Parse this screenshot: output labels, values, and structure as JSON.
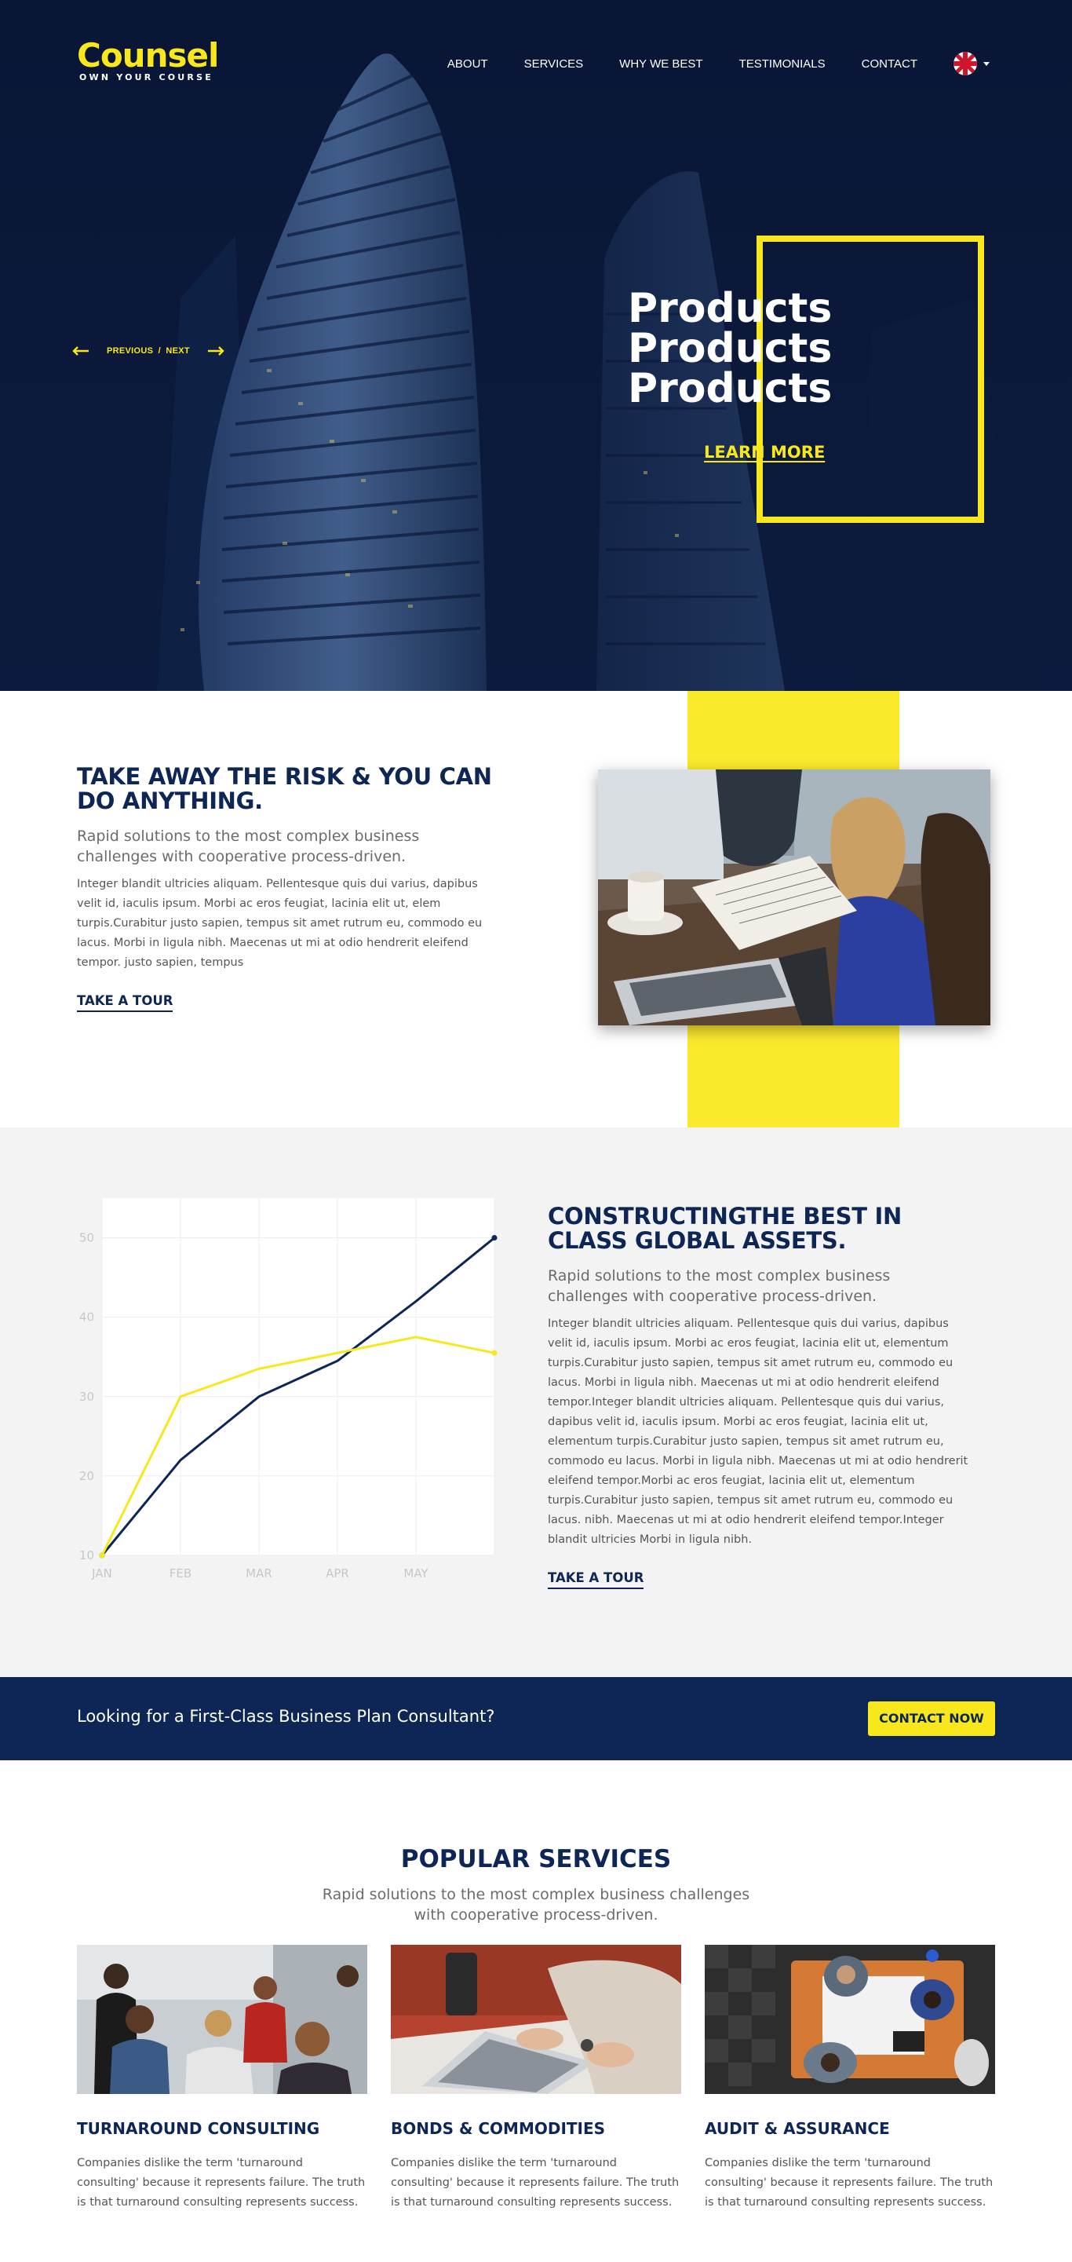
{
  "brand": {
    "name": "Counsel",
    "tagline": "OWN YOUR COURSE",
    "accent": "#f8e71c",
    "navy": "#0d2656"
  },
  "nav": {
    "items": [
      {
        "label": "ABOUT"
      },
      {
        "label": "SERVICES"
      },
      {
        "label": "WHY WE BEST"
      },
      {
        "label": "TESTIMONIALS"
      },
      {
        "label": "CONTACT"
      }
    ],
    "language_icon": "uk-flag-icon"
  },
  "hero": {
    "title_lines": [
      "Products",
      "Products",
      "Products"
    ],
    "cta": "LEARN MORE",
    "slider": {
      "prev": "PREVIOUS",
      "separator": "/",
      "next": "NEXT"
    }
  },
  "about": {
    "title": "TAKE AWAY THE RISK & YOU CAN DO ANYTHING.",
    "subtitle": "Rapid solutions to the most complex business challenges with cooperative process-driven.",
    "body": "Integer blandit ultricies aliquam. Pellentesque quis dui varius, dapibus velit id, iaculis ipsum. Morbi ac eros feugiat, lacinia elit ut, elem turpis.Curabitur justo sapien, tempus sit amet rutrum eu, commodo eu lacus. Morbi in ligula nibh. Maecenas ut mi at odio hendrerit eleifend tempor. justo sapien, tempus",
    "link": "TAKE A TOUR"
  },
  "assets": {
    "title": "CONSTRUCTINGTHE BEST IN CLASS GLOBAL ASSETS.",
    "subtitle": "Rapid solutions to the most complex business challenges with cooperative process-driven.",
    "body": "Integer blandit ultricies aliquam. Pellentesque quis dui varius, dapibus velit id, iaculis ipsum. Morbi ac eros feugiat, lacinia elit ut, elementum turpis.Curabitur justo sapien, tempus sit amet rutrum eu, commodo eu lacus. Morbi in ligula nibh. Maecenas ut mi at odio hendrerit eleifend tempor.Integer blandit ultricies aliquam. Pellentesque quis dui varius, dapibus velit id, iaculis ipsum. Morbi ac eros feugiat, lacinia elit ut, elementum turpis.Curabitur justo sapien, tempus sit amet rutrum eu, commodo eu lacus. Morbi in ligula nibh. Maecenas ut mi at odio hendrerit eleifend tempor.Morbi ac eros feugiat, lacinia elit ut, elementum turpis.Curabitur justo sapien, tempus sit amet rutrum eu, commodo eu lacus. nibh. Maecenas ut mi at odio hendrerit eleifend tempor.Integer blandit ultricies Morbi in ligula nibh.",
    "link": "TAKE A TOUR"
  },
  "chart_data": {
    "type": "line",
    "title": "",
    "xlabel": "",
    "ylabel": "",
    "x": [
      "JAN",
      "FEB",
      "MAR",
      "APR",
      "MAY",
      ""
    ],
    "yticks": [
      10,
      20,
      30,
      40,
      50
    ],
    "ylim": [
      10,
      55
    ],
    "grid": true,
    "legend": "none",
    "series": [
      {
        "color": "#0d2656",
        "values": [
          10,
          22,
          30,
          34.5,
          42,
          50
        ]
      },
      {
        "color": "#f8e71c",
        "values": [
          10,
          30,
          33.5,
          35.5,
          37.5,
          35.5
        ]
      }
    ]
  },
  "cta": {
    "text": "Looking for a First-Class Business Plan Consultant?",
    "button": "CONTACT NOW"
  },
  "services": {
    "title": "POPULAR SERVICES",
    "subtitle": "Rapid solutions to the most complex business challenges with cooperative process-driven.",
    "cards": [
      {
        "title": "TURNAROUND CONSULTING",
        "desc": "Companies dislike the term 'turnaround consulting' because it represents failure. The truth is that turnaround consulting represents success."
      },
      {
        "title": "BONDS & COMMODITIES",
        "desc": "Companies dislike the term 'turnaround consulting' because it represents failure. The truth is that turnaround consulting represents success."
      },
      {
        "title": "AUDIT & ASSURANCE",
        "desc": "Companies dislike the term 'turnaround consulting' because it represents failure. The truth is that turnaround consulting represents success."
      }
    ]
  }
}
